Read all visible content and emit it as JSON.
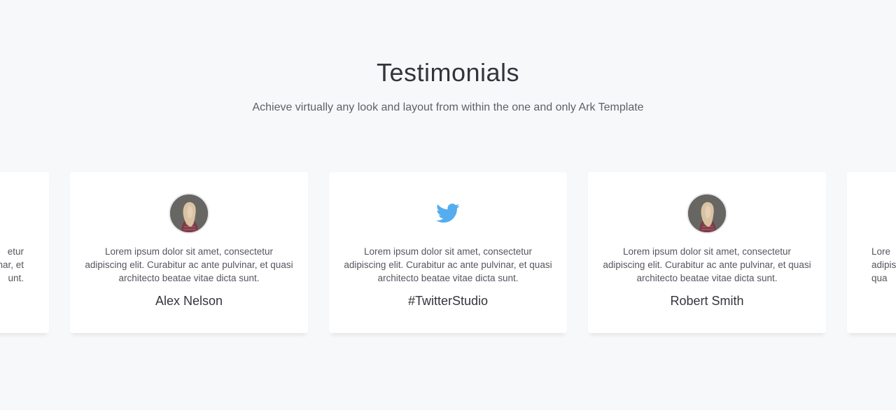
{
  "section": {
    "title": "Testimonials",
    "subtitle": "Achieve virtually any look and layout from within the one and only Ark Template"
  },
  "cards": [
    {
      "media": "avatar",
      "quote_visible": "etur\nnar, et\nunt.",
      "line1": "etur",
      "line2": "nar, et",
      "line3": "unt.",
      "name": ""
    },
    {
      "media": "avatar",
      "quote": "Lorem ipsum dolor sit amet, consectetur adipiscing elit. Curabitur ac ante pulvinar, et quasi architecto beatae vitae dicta sunt.",
      "name": "Alex Nelson"
    },
    {
      "media": "twitter-icon",
      "quote": "Lorem ipsum dolor sit amet, consectetur adipiscing elit. Curabitur ac ante pulvinar, et quasi architecto beatae vitae dicta sunt.",
      "name": "#TwitterStudio"
    },
    {
      "media": "avatar",
      "quote": "Lorem ipsum dolor sit amet, consectetur adipiscing elit. Curabitur ac ante pulvinar, et quasi architecto beatae vitae dicta sunt.",
      "name": "Robert Smith"
    },
    {
      "media": "avatar",
      "line1": "Lore",
      "line2": "adipis",
      "line3": "qua",
      "name": ""
    }
  ],
  "colors": {
    "background": "#f7f8fa",
    "card": "#ffffff",
    "twitter": "#55acee"
  }
}
